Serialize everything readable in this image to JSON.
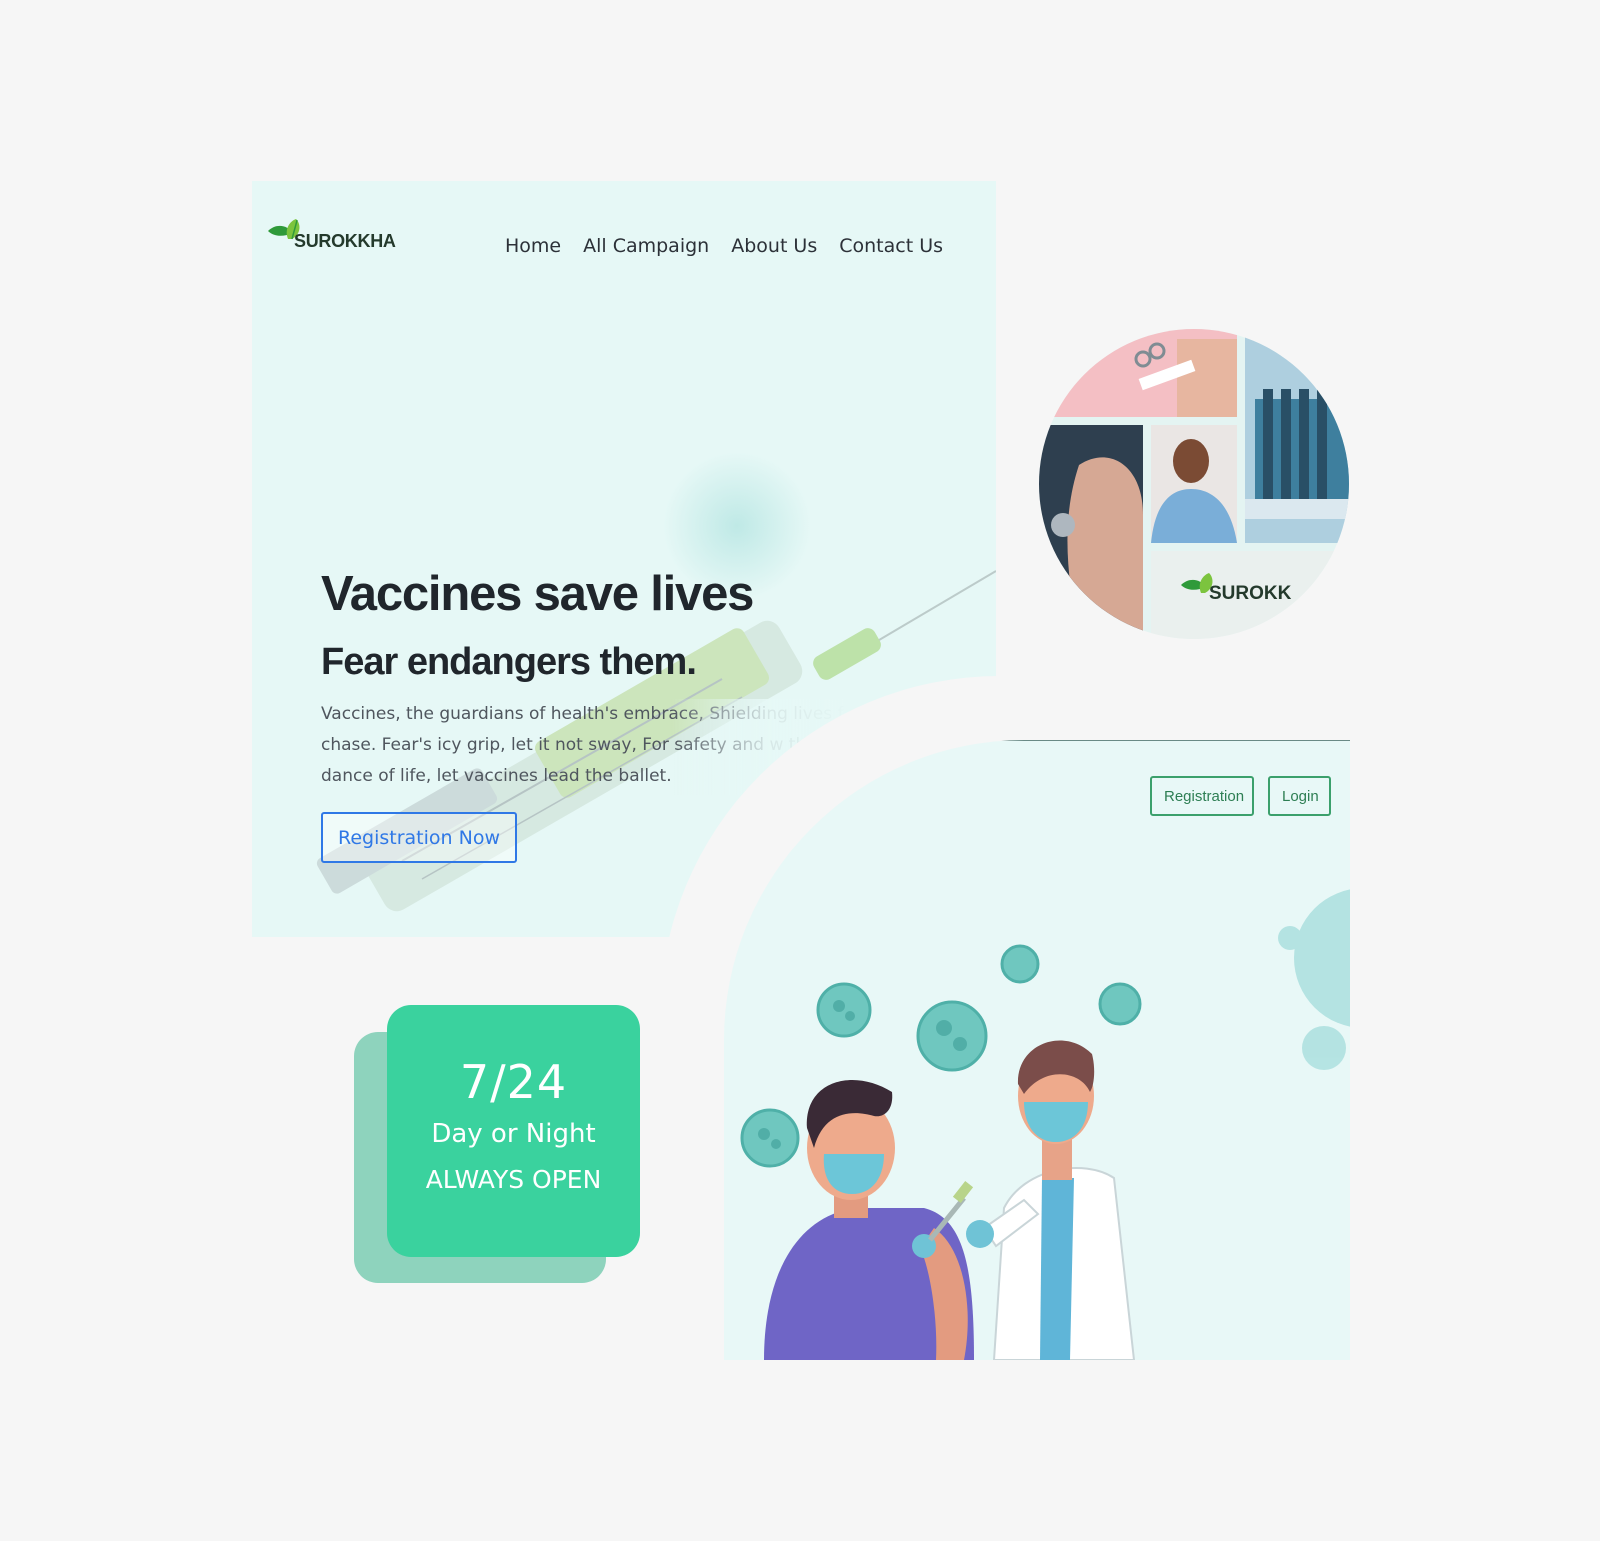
{
  "brand": {
    "name": "SUROKKHA"
  },
  "nav": {
    "items": [
      {
        "label": "Home"
      },
      {
        "label": "All Campaign"
      },
      {
        "label": "About Us"
      },
      {
        "label": "Contact Us"
      }
    ]
  },
  "hero": {
    "title": "Vaccines save lives",
    "subtitle": "Fear endangers them.",
    "description": "Vaccines, the guardians of health's embrace, Shielding lives f chase. Fear's icy grip, let it not sway, For safety and w the dance of life, let vaccines lead the ballet.",
    "cta_label": "Registration Now"
  },
  "auth": {
    "register_label": "Registration",
    "login_label": "Login"
  },
  "collage": {
    "logo_text": "SUROKK"
  },
  "badge": {
    "hours": "7/24",
    "line2": "Day or Night",
    "line3": "ALWAYS OPEN"
  },
  "colors": {
    "page_bg": "#f6f6f6",
    "hero_bg": "#e6f8f6",
    "accent_green": "#3ad29e",
    "badge_shadow": "#8ed3bd",
    "cta_blue": "#2f78e6",
    "auth_green": "#3ba06c",
    "leaf_green": "#2f9a3a"
  },
  "icons": [
    "leaf-logo-icon",
    "syringe-graphic",
    "virus-icon"
  ]
}
